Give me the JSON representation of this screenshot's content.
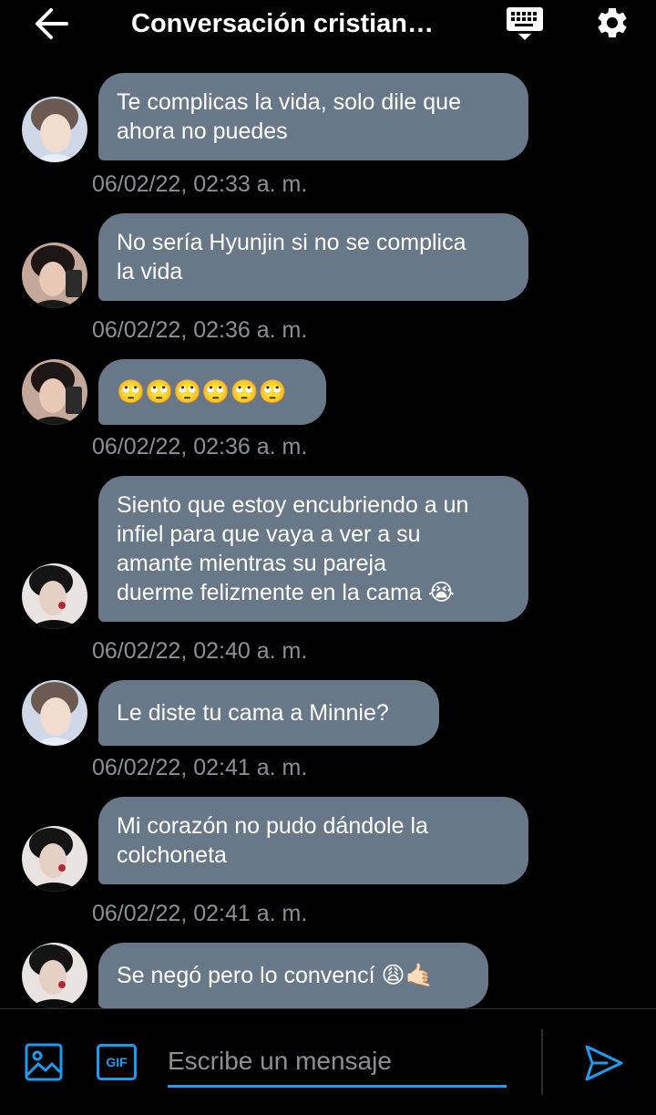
{
  "header": {
    "title": "Conversación cristian…",
    "back_icon": "arrow-left-icon",
    "keyboard_icon": "keyboard-icon",
    "settings_icon": "gear-icon"
  },
  "messages": [
    {
      "avatar": "avatar-light",
      "lines": [
        "Te complicas la vida, solo dile que",
        "ahora no puedes"
      ],
      "timestamp": "06/02/22, 02:33 a. m."
    },
    {
      "avatar": "avatar-dark-hair",
      "lines": [
        "No sería Hyunjin si no se complica",
        "la vida"
      ],
      "timestamp": "06/02/22, 02:36 a. m."
    },
    {
      "avatar": "avatar-dark-hair",
      "lines": [
        "🙄🙄🙄🙄🙄🙄"
      ],
      "timestamp": "06/02/22, 02:36 a. m."
    },
    {
      "avatar": "avatar-black",
      "lines": [
        "Siento que estoy encubriendo a un",
        "infiel para que vaya a ver a su",
        "amante mientras su pareja",
        "duerme felizmente en la cama 😭"
      ],
      "timestamp": "06/02/22, 02:40 a. m."
    },
    {
      "avatar": "avatar-light",
      "lines": [
        "Le diste tu cama a Minnie?"
      ],
      "timestamp": "06/02/22, 02:41 a. m."
    },
    {
      "avatar": "avatar-black",
      "lines": [
        "Mi corazón no pudo dándole la",
        "colchoneta"
      ],
      "timestamp": "06/02/22, 02:41 a. m."
    },
    {
      "avatar": "avatar-black",
      "lines": [
        "Se negó pero lo convencí 😩🤙🏻"
      ],
      "timestamp": ""
    }
  ],
  "composer": {
    "placeholder": "Escribe un mensaje",
    "value": "",
    "image_icon": "image-icon",
    "gif_label": "GIF",
    "send_icon": "send-icon"
  },
  "colors": {
    "background": "#000000",
    "bubble": "#687889",
    "accent": "#1d9bf0",
    "timestamp": "#8a9096"
  }
}
